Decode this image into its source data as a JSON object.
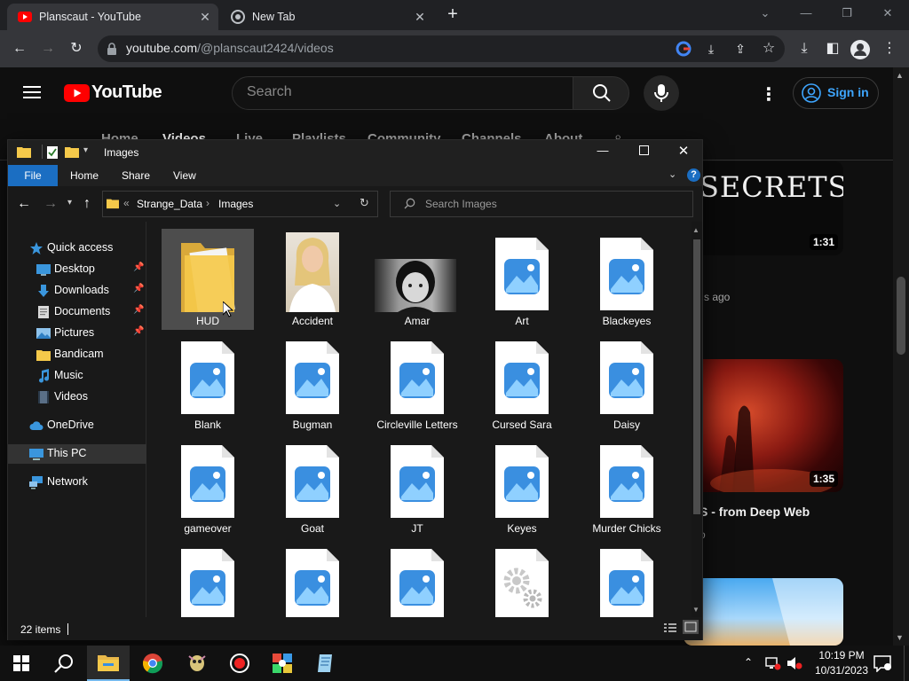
{
  "browser": {
    "tabs": [
      {
        "title": "Planscaut - YouTube",
        "active": true
      },
      {
        "title": "New Tab",
        "active": false
      }
    ],
    "url": {
      "host": "youtube.com",
      "path": "/@planscaut2424/videos"
    }
  },
  "youtube": {
    "logo": "YouTube",
    "search_placeholder": "Search",
    "sign_in": "Sign in",
    "channel_tabs": [
      "Home",
      "Videos",
      "Live",
      "Playlists",
      "Community",
      "Channels",
      "About"
    ],
    "videos": [
      {
        "thumb_text": "SECRETS",
        "duration": "1:31",
        "meta": "s ago"
      },
      {
        "duration": "1:35",
        "title": "S - from Deep Web",
        "meta": "o"
      },
      {
        "duration": ""
      }
    ]
  },
  "explorer": {
    "window_title": "Images",
    "ribbon": {
      "file": "File",
      "tabs": [
        "Home",
        "Share",
        "View"
      ]
    },
    "address": {
      "breadcrumb": [
        "Strange_Data",
        "Images"
      ]
    },
    "search_placeholder": "Search Images",
    "sidebar": {
      "quick_access": "Quick access",
      "items": [
        {
          "label": "Desktop",
          "pinned": true
        },
        {
          "label": "Downloads",
          "pinned": true
        },
        {
          "label": "Documents",
          "pinned": true
        },
        {
          "label": "Pictures",
          "pinned": true
        },
        {
          "label": "Bandicam",
          "pinned": false
        },
        {
          "label": "Music",
          "pinned": false
        },
        {
          "label": "Videos",
          "pinned": false
        }
      ],
      "onedrive": "OneDrive",
      "this_pc": "This PC",
      "network": "Network"
    },
    "files": [
      {
        "name": "HUD",
        "type": "folder",
        "selected": true
      },
      {
        "name": "Accident",
        "type": "photo"
      },
      {
        "name": "Amar",
        "type": "photo"
      },
      {
        "name": "Art",
        "type": "image"
      },
      {
        "name": "Blackeyes",
        "type": "image"
      },
      {
        "name": "Blank",
        "type": "image"
      },
      {
        "name": "Bugman",
        "type": "image"
      },
      {
        "name": "Circleville Letters",
        "type": "image"
      },
      {
        "name": "Cursed Sara",
        "type": "image"
      },
      {
        "name": "Daisy",
        "type": "image"
      },
      {
        "name": "gameover",
        "type": "image"
      },
      {
        "name": "Goat",
        "type": "image"
      },
      {
        "name": "JT",
        "type": "image"
      },
      {
        "name": "Keyes",
        "type": "image"
      },
      {
        "name": "Murder Chicks",
        "type": "image"
      },
      {
        "name": "",
        "type": "image"
      },
      {
        "name": "",
        "type": "image"
      },
      {
        "name": "",
        "type": "image"
      },
      {
        "name": "",
        "type": "settings"
      },
      {
        "name": "",
        "type": "image"
      }
    ],
    "status": {
      "item_count": "22 items"
    }
  },
  "taskbar": {
    "time": "10:19 PM",
    "date": "10/31/2023"
  },
  "colors": {
    "accent": "#1b6ec2",
    "youtube_red": "#ff0000",
    "link_blue": "#3ea6ff"
  }
}
